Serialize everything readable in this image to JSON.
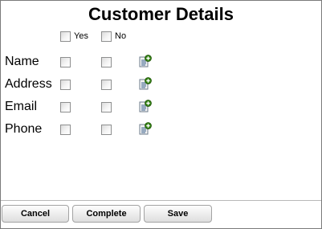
{
  "form": {
    "title": "Customer Details",
    "columns": [
      {
        "label": "Yes",
        "checked": false
      },
      {
        "label": "No",
        "checked": false
      }
    ],
    "rows": [
      {
        "label": "Name",
        "yes": false,
        "no": false,
        "action_icon": "add-note-icon"
      },
      {
        "label": "Address",
        "yes": false,
        "no": false,
        "action_icon": "add-note-icon"
      },
      {
        "label": "Email",
        "yes": false,
        "no": false,
        "action_icon": "add-note-icon"
      },
      {
        "label": "Phone",
        "yes": false,
        "no": false,
        "action_icon": "add-note-icon"
      }
    ]
  },
  "buttons": {
    "cancel": "Cancel",
    "complete": "Complete",
    "save": "Save"
  },
  "colors": {
    "border": "#7a7a7a",
    "checkbox_border": "#8e8f8f",
    "add_icon_green": "#2f7d0f",
    "button_border": "#a3a3a3"
  }
}
